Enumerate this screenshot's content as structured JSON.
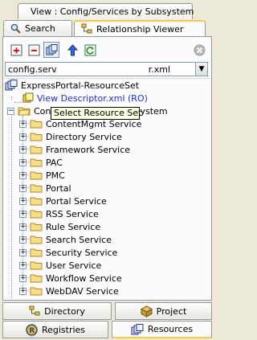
{
  "view_header": {
    "title": "View : Config/Services by Subsystem"
  },
  "tabs_top": [
    {
      "label": "Search",
      "icon": "magnifier-icon",
      "active": false
    },
    {
      "label": "Relationship Viewer",
      "icon": "relationship-icon",
      "active": true
    }
  ],
  "toolbar": {
    "tooltip": "Select Resource Set",
    "buttons": [
      "add-icon",
      "remove-icon",
      "select-resource-set-icon",
      "upload-icon",
      "refresh-icon",
      "disabled-icon"
    ]
  },
  "combo": {
    "value": "config.serv",
    "value_tail": "r.xml"
  },
  "tree": {
    "root": "ExpressPortal-ResourceSet",
    "view_descriptor": "View Descriptor.xml (RO)",
    "config_node": "Config/Services by Subsystem",
    "services": [
      "ContentMgmt Service",
      "Directory Service",
      "Framework Service",
      "PAC",
      "PMC",
      "Portal",
      "Portal Service",
      "RSS Service",
      "Rule Service",
      "Search Service",
      "Security Service",
      "User Service",
      "Workflow Service",
      "WebDAV Service"
    ]
  },
  "tabs_bottom": [
    {
      "label": "Directory",
      "icon": "directory-icon",
      "active": false
    },
    {
      "label": "Project",
      "icon": "project-icon",
      "active": false
    },
    {
      "label": "Registries",
      "icon": "registries-icon",
      "active": false
    },
    {
      "label": "Resources",
      "icon": "resources-icon",
      "active": true
    }
  ],
  "colors": {
    "accent": "#ffc83c",
    "link": "#1c31c8",
    "background": "#ece9d8"
  }
}
